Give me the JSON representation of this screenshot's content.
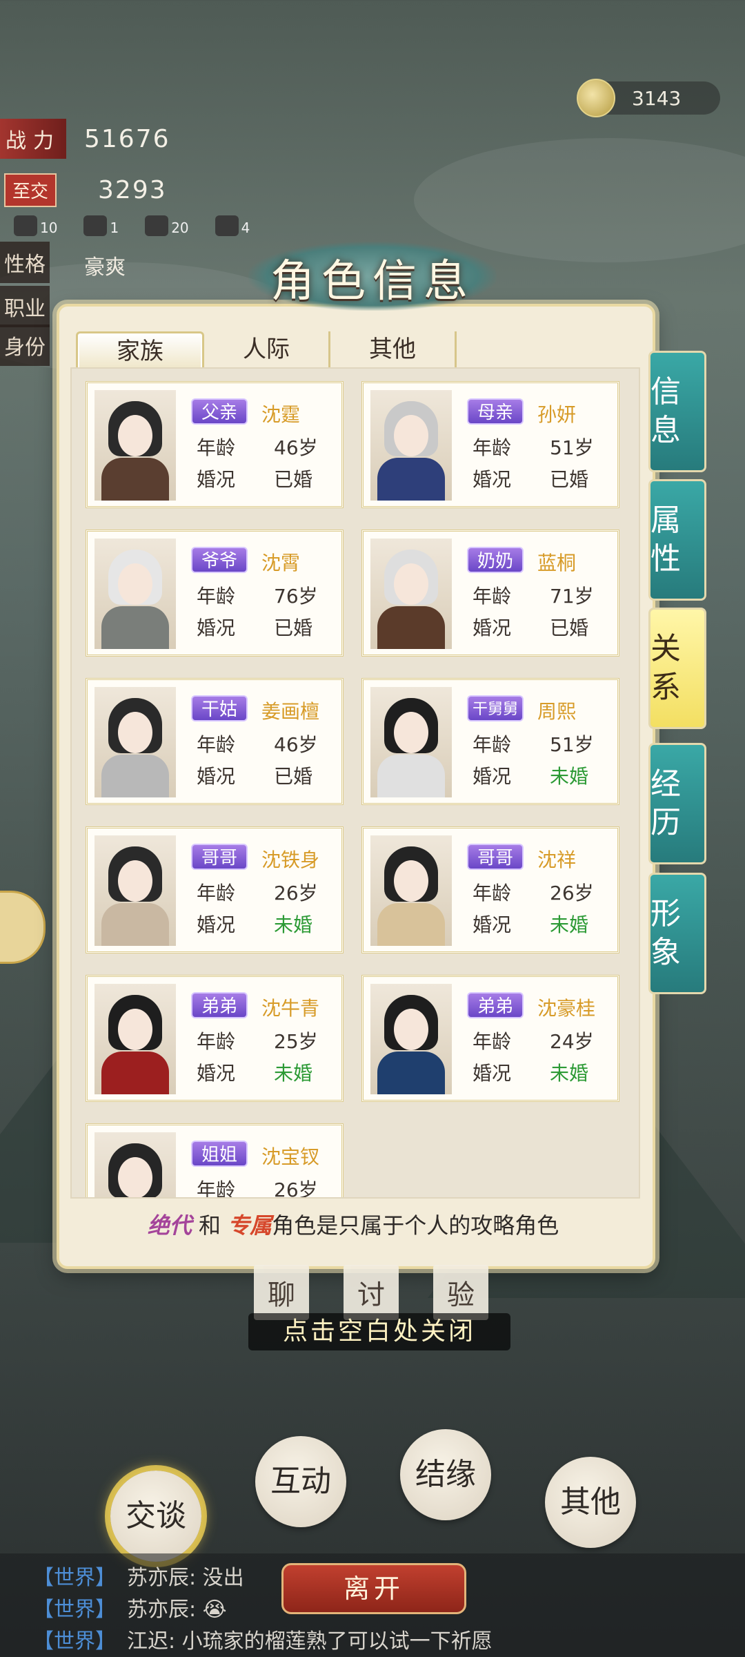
{
  "currency": {
    "value": "3143",
    "icon": "tea-bowl-icon"
  },
  "stats": {
    "power_label": "战力",
    "power_value": "51676",
    "intimacy_badge": "至交",
    "intimacy_value": "3293",
    "personality_label": "性格",
    "personality_value": "豪爽",
    "job_label": "职业",
    "identity_label": "身份"
  },
  "mini_counters": [
    "10",
    "1",
    "20",
    "4"
  ],
  "panel": {
    "title": "角色信息",
    "tabs": [
      "家族",
      "人际",
      "其他"
    ],
    "active_tab": 0,
    "age_label": "年龄",
    "marital_label": "婚况",
    "members": [
      {
        "relation": "父亲",
        "name": "沈霆",
        "age": "46岁",
        "marital": "已婚",
        "single": false,
        "hair": "#2b2b2b",
        "cloth": "#5a3e30"
      },
      {
        "relation": "母亲",
        "name": "孙妍",
        "age": "51岁",
        "marital": "已婚",
        "single": false,
        "hair": "#c9c9c9",
        "cloth": "#2e3f7a"
      },
      {
        "relation": "爷爷",
        "name": "沈霄",
        "age": "76岁",
        "marital": "已婚",
        "single": false,
        "hair": "#e6e6e6",
        "cloth": "#7a7e7a"
      },
      {
        "relation": "奶奶",
        "name": "蓝桐",
        "age": "71岁",
        "marital": "已婚",
        "single": false,
        "hair": "#dedede",
        "cloth": "#5b3b2a"
      },
      {
        "relation": "干姑",
        "name": "姜画檀",
        "age": "46岁",
        "marital": "已婚",
        "single": false,
        "hair": "#2a2a2a",
        "cloth": "#b8b8b8"
      },
      {
        "relation": "干舅舅",
        "name": "周熙",
        "age": "51岁",
        "marital": "未婚",
        "single": true,
        "hair": "#1f1f1f",
        "cloth": "#e0e0e0"
      },
      {
        "relation": "哥哥",
        "name": "沈铁身",
        "age": "26岁",
        "marital": "未婚",
        "single": true,
        "hair": "#2a2a2a",
        "cloth": "#c9b8a2"
      },
      {
        "relation": "哥哥",
        "name": "沈祥",
        "age": "26岁",
        "marital": "未婚",
        "single": true,
        "hair": "#242424",
        "cloth": "#d8c29a"
      },
      {
        "relation": "弟弟",
        "name": "沈牛青",
        "age": "25岁",
        "marital": "未婚",
        "single": true,
        "hair": "#1e1e1e",
        "cloth": "#9c1f1f"
      },
      {
        "relation": "弟弟",
        "name": "沈豪桂",
        "age": "24岁",
        "marital": "未婚",
        "single": true,
        "hair": "#1e1e1e",
        "cloth": "#1f3f6e"
      },
      {
        "relation": "姐姐",
        "name": "沈宝钗",
        "age": "26岁",
        "marital": "",
        "single": false,
        "hair": "#262626",
        "cloth": "#e9e2d4"
      }
    ],
    "note_a": "绝代",
    "note_mid": " 和 ",
    "note_b": "专属",
    "note_rest": "角色是只属于个人的攻略角色"
  },
  "side_tabs": [
    "信息",
    "属性",
    "关系",
    "经历",
    "形象"
  ],
  "active_side_tab": 2,
  "under_buttons": [
    "聊",
    "讨",
    "验"
  ],
  "close_hint": "点击空白处关闭",
  "actions": [
    "交谈",
    "互动",
    "结缘",
    "其他"
  ],
  "leave_button": "离开",
  "chat": [
    {
      "channel": "【世界】",
      "text": "苏亦辰: 没出"
    },
    {
      "channel": "【世界】",
      "text": "苏亦辰: 😭"
    },
    {
      "channel": "【世界】",
      "text": "江迟: 小琉家的榴莲熟了可以试一下祈愿"
    }
  ]
}
